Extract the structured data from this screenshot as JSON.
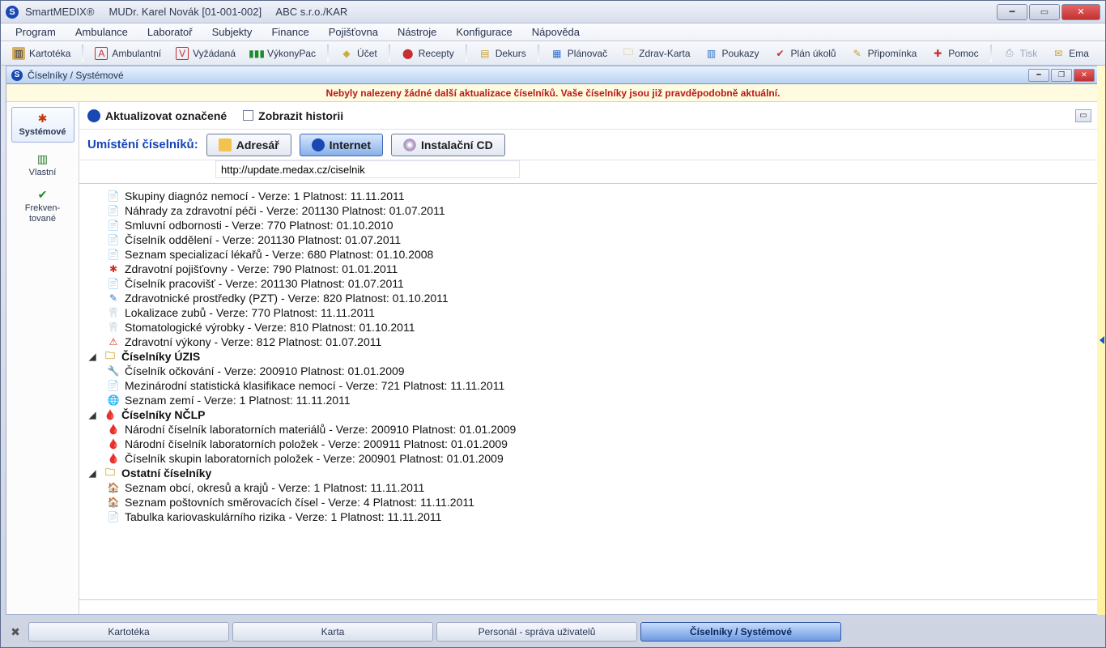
{
  "title": {
    "app": "SmartMEDIX®",
    "user": "MUDr. Karel Novák [01-001-002]",
    "org": "ABC s.r.o./KAR"
  },
  "menu": {
    "program": "Program",
    "ambulance": "Ambulance",
    "laborator": "Laboratoř",
    "subjekty": "Subjekty",
    "finance": "Finance",
    "pojistovna": "Pojišťovna",
    "nastroje": "Nástroje",
    "konfigurace": "Konfigurace",
    "napoveda": "Nápověda"
  },
  "toolbar": {
    "kartoteka": "Kartotéka",
    "ambulantni": "Ambulantní",
    "vyzadana": "Vyžádaná",
    "vykony": "VýkonyPac",
    "ucet": "Účet",
    "recepty": "Recepty",
    "dekurs": "Dekurs",
    "planovac": "Plánovač",
    "zdravkarta": "Zdrav-Karta",
    "poukazy": "Poukazy",
    "plan_ukolu": "Plán úkolů",
    "pripominka": "Připomínka",
    "pomoc": "Pomoc",
    "tisk": "Tisk",
    "email": "Ema"
  },
  "child": {
    "title": "Číselníky / Systémové",
    "banner": "Nebyly nalezeny žádné další aktualizace číselníků. Vaše číselníky jsou již pravděpodobně aktuální."
  },
  "left": {
    "systemove": "Systémové",
    "vlastni": "Vlastní",
    "frekventovane": "Frekven-\ntované"
  },
  "actions": {
    "aktualizovat": "Aktualizovat označené",
    "historie": "Zobrazit historii"
  },
  "loc": {
    "label": "Umístění číselníků:",
    "adresar": "Adresář",
    "internet": "Internet",
    "cd": "Instalační CD",
    "url": "http://update.medax.cz/ciselnik"
  },
  "tree": {
    "items": [
      {
        "t": "Skupiny diagnóz nemocí - Verze: 1  Platnost: 11.11.2011",
        "ico": "doc"
      },
      {
        "t": "Náhrady za zdravotní péči - Verze: 201130  Platnost: 01.07.2011",
        "ico": "doc"
      },
      {
        "t": "Smluvní odbornosti - Verze: 770  Platnost: 01.10.2010",
        "ico": "doc"
      },
      {
        "t": "Číselník oddělení - Verze: 201130  Platnost: 01.07.2011",
        "ico": "doc"
      },
      {
        "t": "Seznam specializací lékařů - Verze: 680  Platnost: 01.10.2008",
        "ico": "doc"
      },
      {
        "t": "Zdravotní pojišťovny - Verze: 790  Platnost: 01.01.2011",
        "ico": "red"
      },
      {
        "t": "Číselník pracovišť - Verze: 201130  Platnost: 01.07.2011",
        "ico": "doc"
      },
      {
        "t": "Zdravotnické prostředky (PZT)  - Verze: 820  Platnost: 01.10.2011",
        "ico": "pencil"
      },
      {
        "t": "Lokalizace zubů - Verze: 770  Platnost: 11.11.2011",
        "ico": "tooth"
      },
      {
        "t": "Stomatologické výrobky  - Verze: 810  Platnost: 01.10.2011",
        "ico": "tooth"
      },
      {
        "t": "Zdravotní výkony - Verze: 812  Platnost: 01.07.2011",
        "ico": "warn"
      }
    ],
    "group_uzis": "Číselníky ÚZIS",
    "uzis": [
      {
        "t": "Číselník očkování - Verze: 200910  Platnost: 01.01.2009",
        "ico": "wrench"
      },
      {
        "t": "Mezinárodní statistická klasifikace nemocí - Verze: 721  Platnost: 11.11.2011",
        "ico": "doc"
      },
      {
        "t": "Seznam zemí - Verze: 1  Platnost: 11.11.2011",
        "ico": "globe"
      }
    ],
    "group_nclp": "Číselníky NČLP",
    "nclp": [
      {
        "t": "Národní číselník laboratorních materiálů - Verze: 200910  Platnost: 01.01.2009",
        "ico": "blood"
      },
      {
        "t": "Národní číselník laboratorních položek - Verze: 200911  Platnost: 01.01.2009",
        "ico": "blood"
      },
      {
        "t": "Číselník skupin laboratorních položek - Verze: 200901  Platnost: 01.01.2009",
        "ico": "blood"
      }
    ],
    "group_ost": "Ostatní číselníky",
    "ost": [
      {
        "t": "Seznam obcí, okresů a krajů - Verze: 1  Platnost: 11.11.2011",
        "ico": "house"
      },
      {
        "t": "Seznam poštovních směrovacích čísel - Verze: 4  Platnost: 11.11.2011",
        "ico": "house"
      },
      {
        "t": "Tabulka kariovaskulárního rizika - Verze: 1  Platnost: 11.11.2011",
        "ico": "doc"
      }
    ]
  },
  "tasks": {
    "kartoteka": "Kartotéka",
    "karta": "Karta",
    "personal": "Personál - správa uživatelů",
    "ciselniky": "Číselníky / Systémové"
  }
}
